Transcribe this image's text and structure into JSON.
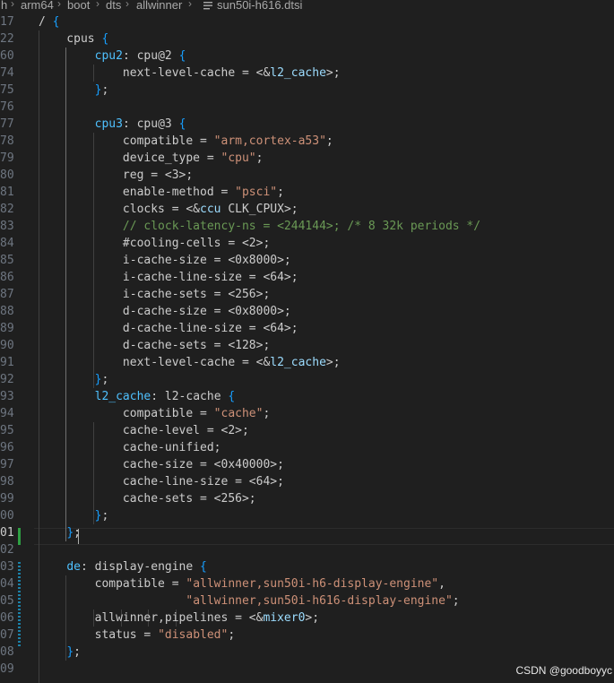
{
  "breadcrumb": {
    "items": [
      "h",
      "arm64",
      "boot",
      "dts",
      "allwinner"
    ],
    "file": "sun50i-h616.dtsi"
  },
  "editor": {
    "lines": [
      {
        "n": "17",
        "t": "/ {"
      },
      {
        "n": "22",
        "t": "    cpus {"
      },
      {
        "n": "60",
        "t": "        cpu2: cpu@2 {"
      },
      {
        "n": "74",
        "t": "            next-level-cache = <&l2_cache>;"
      },
      {
        "n": "75",
        "t": "        };"
      },
      {
        "n": "76",
        "t": ""
      },
      {
        "n": "77",
        "t": "        cpu3: cpu@3 {"
      },
      {
        "n": "78",
        "t": "            compatible = \"arm,cortex-a53\";"
      },
      {
        "n": "79",
        "t": "            device_type = \"cpu\";"
      },
      {
        "n": "80",
        "t": "            reg = <3>;"
      },
      {
        "n": "81",
        "t": "            enable-method = \"psci\";"
      },
      {
        "n": "82",
        "t": "            clocks = <&ccu CLK_CPUX>;"
      },
      {
        "n": "83",
        "t": "            // clock-latency-ns = <244144>; /* 8 32k periods */"
      },
      {
        "n": "84",
        "t": "            #cooling-cells = <2>;"
      },
      {
        "n": "85",
        "t": "            i-cache-size = <0x8000>;"
      },
      {
        "n": "86",
        "t": "            i-cache-line-size = <64>;"
      },
      {
        "n": "87",
        "t": "            i-cache-sets = <256>;"
      },
      {
        "n": "88",
        "t": "            d-cache-size = <0x8000>;"
      },
      {
        "n": "89",
        "t": "            d-cache-line-size = <64>;"
      },
      {
        "n": "90",
        "t": "            d-cache-sets = <128>;"
      },
      {
        "n": "91",
        "t": "            next-level-cache = <&l2_cache>;"
      },
      {
        "n": "92",
        "t": "        };"
      },
      {
        "n": "93",
        "t": "        l2_cache: l2-cache {"
      },
      {
        "n": "94",
        "t": "            compatible = \"cache\";"
      },
      {
        "n": "95",
        "t": "            cache-level = <2>;"
      },
      {
        "n": "96",
        "t": "            cache-unified;"
      },
      {
        "n": "97",
        "t": "            cache-size = <0x40000>;"
      },
      {
        "n": "98",
        "t": "            cache-line-size = <64>;"
      },
      {
        "n": "99",
        "t": "            cache-sets = <256>;"
      },
      {
        "n": "00",
        "t": "        };"
      },
      {
        "n": "01",
        "t": "    };"
      },
      {
        "n": "02",
        "t": ""
      },
      {
        "n": "03",
        "t": "    de: display-engine {"
      },
      {
        "n": "04",
        "t": "        compatible = \"allwinner,sun50i-h6-display-engine\","
      },
      {
        "n": "05",
        "t": "                     \"allwinner,sun50i-h616-display-engine\";"
      },
      {
        "n": "06",
        "t": "        allwinner,pipelines = <&mixer0>;"
      },
      {
        "n": "07",
        "t": "        status = \"disabled\";"
      },
      {
        "n": "08",
        "t": "    };"
      },
      {
        "n": "09",
        "t": ""
      }
    ]
  },
  "watermark": "CSDN @goodboyyc"
}
